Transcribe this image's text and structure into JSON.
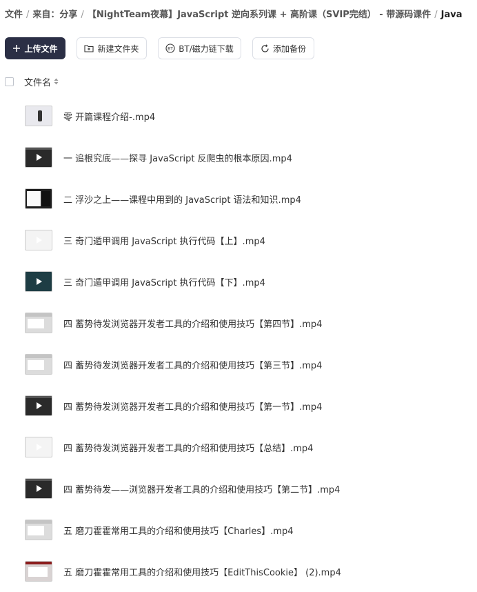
{
  "breadcrumb": {
    "items": [
      "文件",
      "来自：分享",
      "【NightTeam夜幕】JavaScript 逆向系列课 + 高阶课（SVIP完结） - 带源码课件",
      "Java"
    ],
    "separator": "/"
  },
  "toolbar": {
    "upload_label": "上传文件",
    "new_folder_label": "新建文件夹",
    "bt_label": "BT/磁力链下载",
    "backup_label": "添加备份"
  },
  "list_header": {
    "filename_label": "文件名"
  },
  "files": [
    {
      "name": "零 开篇课程介绍-.mp4",
      "thumb": "light"
    },
    {
      "name": "一 追根究底——探寻 JavaScript 反爬虫的根本原因.mp4",
      "thumb": "dark"
    },
    {
      "name": "二 浮沙之上——课程中用到的 JavaScript 语法和知识.mp4",
      "thumb": "code"
    },
    {
      "name": "三 奇门遁甲调用 JavaScript 执行代码【上】.mp4",
      "thumb": "white"
    },
    {
      "name": "三 奇门遁甲调用 JavaScript 执行代码【下】.mp4",
      "thumb": "teal"
    },
    {
      "name": "四 蓄势待发浏览器开发者工具的介绍和使用技巧【第四节】.mp4",
      "thumb": "gray"
    },
    {
      "name": "四 蓄势待发浏览器开发者工具的介绍和使用技巧【第三节】.mp4",
      "thumb": "gray"
    },
    {
      "name": "四 蓄势待发浏览器开发者工具的介绍和使用技巧【第一节】.mp4",
      "thumb": "dark"
    },
    {
      "name": "四 蓄势待发浏览器开发者工具的介绍和使用技巧【总结】.mp4",
      "thumb": "white"
    },
    {
      "name": "四 蓄势待发——浏览器开发者工具的介绍和使用技巧【第二节】.mp4",
      "thumb": "dark"
    },
    {
      "name": "五 磨刀霍霍常用工具的介绍和使用技巧【Charles】.mp4",
      "thumb": "gray"
    },
    {
      "name": "五 磨刀霍霍常用工具的介绍和使用技巧【EditThisCookie】 (2).mp4",
      "thumb": "red"
    }
  ],
  "colors": {
    "primary_button": "#2b2f45",
    "border": "#dcdfe6"
  }
}
